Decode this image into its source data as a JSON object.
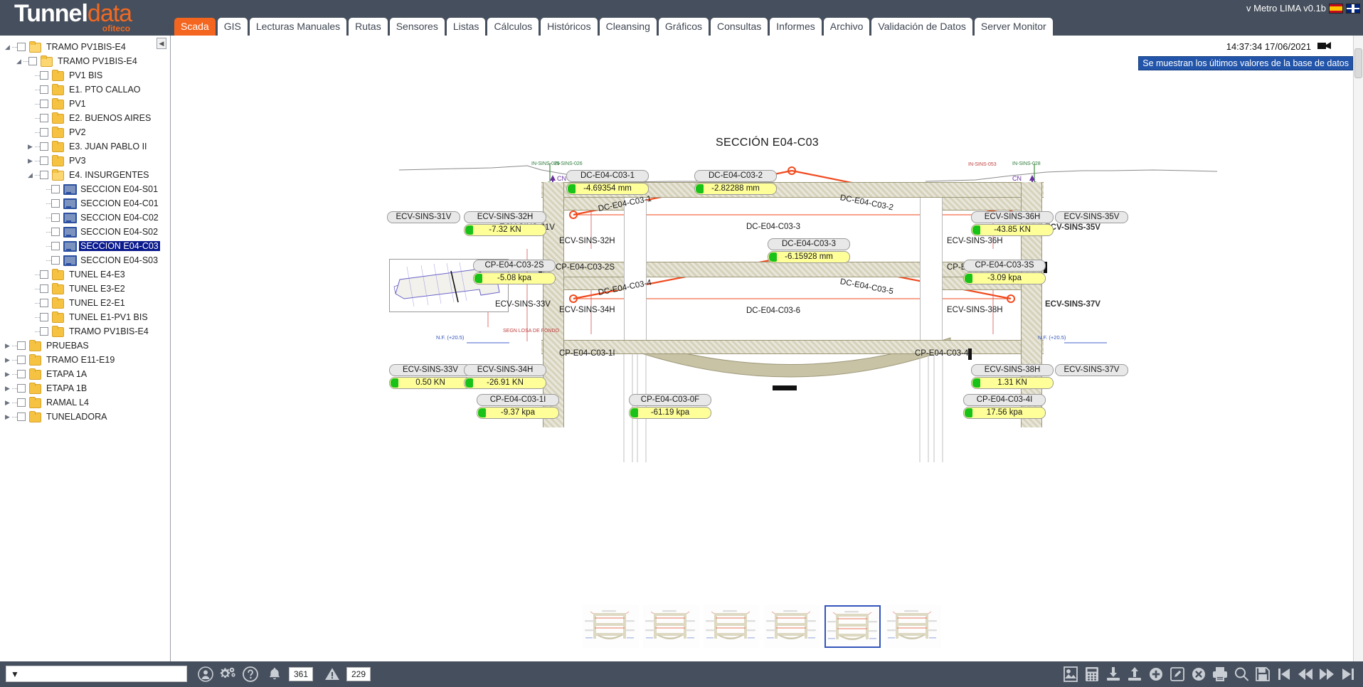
{
  "app": {
    "logo_main": "Tunnel",
    "logo_accent": "data",
    "logo_sub": "ofiteco",
    "version": "v Metro LIMA v0.1b",
    "flag_es": "spain-flag",
    "flag_en": "uk-flag"
  },
  "tabs": [
    {
      "label": "Scada",
      "active": true
    },
    {
      "label": "GIS",
      "active": false
    },
    {
      "label": "Lecturas Manuales",
      "active": false
    },
    {
      "label": "Rutas",
      "active": false
    },
    {
      "label": "Sensores",
      "active": false
    },
    {
      "label": "Listas",
      "active": false
    },
    {
      "label": "Cálculos",
      "active": false
    },
    {
      "label": "Históricos",
      "active": false
    },
    {
      "label": "Cleansing",
      "active": false
    },
    {
      "label": "Gráficos",
      "active": false
    },
    {
      "label": "Consultas",
      "active": false
    },
    {
      "label": "Informes",
      "active": false
    },
    {
      "label": "Archivo",
      "active": false
    },
    {
      "label": "Validación de Datos",
      "active": false
    },
    {
      "label": "Server Monitor",
      "active": false
    }
  ],
  "sidebar": {
    "collapse_label": "◀",
    "nodes": [
      {
        "label": "TRAMO PV1BIS-E4",
        "depth": 0,
        "icon": "folder-open",
        "twisty": "expanded",
        "selected": false
      },
      {
        "label": "TRAMO PV1BIS-E4",
        "depth": 1,
        "icon": "folder-open",
        "twisty": "expanded",
        "selected": false
      },
      {
        "label": "PV1 BIS",
        "depth": 2,
        "icon": "folder",
        "twisty": "none",
        "selected": false
      },
      {
        "label": "E1. PTO CALLAO",
        "depth": 2,
        "icon": "folder",
        "twisty": "none",
        "selected": false
      },
      {
        "label": "PV1",
        "depth": 2,
        "icon": "folder",
        "twisty": "none",
        "selected": false
      },
      {
        "label": "E2. BUENOS AIRES",
        "depth": 2,
        "icon": "folder",
        "twisty": "none",
        "selected": false
      },
      {
        "label": "PV2",
        "depth": 2,
        "icon": "folder",
        "twisty": "none",
        "selected": false
      },
      {
        "label": "E3. JUAN PABLO II",
        "depth": 2,
        "icon": "folder",
        "twisty": "collapsed",
        "selected": false
      },
      {
        "label": "PV3",
        "depth": 2,
        "icon": "folder",
        "twisty": "collapsed",
        "selected": false
      },
      {
        "label": "E4. INSURGENTES",
        "depth": 2,
        "icon": "folder-open",
        "twisty": "expanded",
        "selected": false
      },
      {
        "label": "SECCION E04-S01",
        "depth": 3,
        "icon": "monitor",
        "twisty": "none",
        "selected": false
      },
      {
        "label": "SECCION E04-C01",
        "depth": 3,
        "icon": "monitor",
        "twisty": "none",
        "selected": false
      },
      {
        "label": "SECCION E04-C02",
        "depth": 3,
        "icon": "monitor",
        "twisty": "none",
        "selected": false
      },
      {
        "label": "SECCION E04-S02",
        "depth": 3,
        "icon": "monitor",
        "twisty": "none",
        "selected": false
      },
      {
        "label": "SECCION E04-C03",
        "depth": 3,
        "icon": "monitor",
        "twisty": "none",
        "selected": true
      },
      {
        "label": "SECCION E04-S03",
        "depth": 3,
        "icon": "monitor",
        "twisty": "none",
        "selected": false
      },
      {
        "label": "TUNEL E4-E3",
        "depth": 2,
        "icon": "folder",
        "twisty": "none",
        "selected": false
      },
      {
        "label": "TUNEL E3-E2",
        "depth": 2,
        "icon": "folder",
        "twisty": "none",
        "selected": false
      },
      {
        "label": "TUNEL E2-E1",
        "depth": 2,
        "icon": "folder",
        "twisty": "none",
        "selected": false
      },
      {
        "label": "TUNEL E1-PV1 BIS",
        "depth": 2,
        "icon": "folder",
        "twisty": "none",
        "selected": false
      },
      {
        "label": "TRAMO PV1BIS-E4",
        "depth": 2,
        "icon": "folder",
        "twisty": "none",
        "selected": false
      },
      {
        "label": "PRUEBAS",
        "depth": 0,
        "icon": "folder",
        "twisty": "collapsed",
        "selected": false
      },
      {
        "label": "TRAMO E11-E19",
        "depth": 0,
        "icon": "folder",
        "twisty": "collapsed",
        "selected": false
      },
      {
        "label": "ETAPA 1A",
        "depth": 0,
        "icon": "folder",
        "twisty": "collapsed",
        "selected": false
      },
      {
        "label": "ETAPA 1B",
        "depth": 0,
        "icon": "folder",
        "twisty": "collapsed",
        "selected": false
      },
      {
        "label": "RAMAL L4",
        "depth": 0,
        "icon": "folder",
        "twisty": "collapsed",
        "selected": false
      },
      {
        "label": "TUNELADORA",
        "depth": 0,
        "icon": "folder",
        "twisty": "collapsed",
        "selected": false
      }
    ]
  },
  "main": {
    "timestamp": "14:37:34 17/06/2021",
    "banner": "Se muestran los últimos valores de la base de datos",
    "diagram_title": "SECCIÓN E04-C03"
  },
  "sensors": [
    {
      "name": "DC-E04-C03-1",
      "value": "-4.69354 mm",
      "status": "ok"
    },
    {
      "name": "DC-E04-C03-2",
      "value": "-2.82288 mm",
      "status": "ok"
    },
    {
      "name": "ECV-SINS-32H",
      "value": "-7.32 KN",
      "status": "ok"
    },
    {
      "name": "ECV-SINS-36H",
      "value": "-43.85 KN",
      "status": "ok"
    },
    {
      "name": "DC-E04-C03-3",
      "value": "-6.15928 mm",
      "status": "ok"
    },
    {
      "name": "CP-E04-C03-2S",
      "value": "-5.08 kpa",
      "status": "ok"
    },
    {
      "name": "CP-E04-C03-3S",
      "value": "-3.09 kpa",
      "status": "ok"
    },
    {
      "name": "ECV-SINS-33V",
      "value": "0.50 KN",
      "status": "ok"
    },
    {
      "name": "ECV-SINS-34H",
      "value": "-26.91 KN",
      "status": "ok"
    },
    {
      "name": "ECV-SINS-38H",
      "value": "1.31 KN",
      "status": "ok"
    },
    {
      "name": "CP-E04-C03-1I",
      "value": "-9.37 kpa",
      "status": "ok"
    },
    {
      "name": "CP-E04-C03-0F",
      "value": "-61.19 kpa",
      "status": "ok"
    },
    {
      "name": "CP-E04-C03-4I",
      "value": "17.56 kpa",
      "status": "ok"
    }
  ],
  "pills": [
    {
      "label": "ECV-SINS-31V"
    },
    {
      "label": "ECV-SINS-35V"
    },
    {
      "label": "ECV-SINS-37V"
    }
  ],
  "diagram_labels": [
    {
      "label": "ECV-SINS-31V"
    },
    {
      "label": "ECV-SINS-32H"
    },
    {
      "label": "ECV-SINS-33V"
    },
    {
      "label": "ECV-SINS-34H"
    },
    {
      "label": "ECV-SINS-35V"
    },
    {
      "label": "ECV-SINS-36H"
    },
    {
      "label": "ECV-SINS-37V"
    },
    {
      "label": "ECV-SINS-38H"
    },
    {
      "label": "DC-E04-C03-1"
    },
    {
      "label": "DC-E04-C03-2"
    },
    {
      "label": "DC-E04-C03-3"
    },
    {
      "label": "DC-E04-C03-4"
    },
    {
      "label": "DC-E04-C03-5"
    },
    {
      "label": "DC-E04-C03-6"
    },
    {
      "label": "CP-E04-C03-2S"
    },
    {
      "label": "CP-E04-C03-3S"
    },
    {
      "label": "CP-E04-C03-1I"
    },
    {
      "label": "CP-E04-C03-4I"
    },
    {
      "label": "CN"
    },
    {
      "label": "IN-SINS-025"
    },
    {
      "label": "IN-SINS-026"
    },
    {
      "label": "IN-SINS-028"
    },
    {
      "label": "IN-SINS-053"
    },
    {
      "label": "N.F. (+20.5)"
    },
    {
      "label": "SEGN LOSA DE FONDO"
    }
  ],
  "thumbnails": [
    {
      "index": 1,
      "selected": false
    },
    {
      "index": 2,
      "selected": false
    },
    {
      "index": 3,
      "selected": false
    },
    {
      "index": 4,
      "selected": false
    },
    {
      "index": 5,
      "selected": true
    },
    {
      "index": 6,
      "selected": false
    }
  ],
  "statusbar": {
    "filter_value": "",
    "filter_placeholder": "",
    "alarm_count": "361",
    "warning_count": "229",
    "icons": [
      "filter-icon",
      "user-icon",
      "gears-icon",
      "help-icon",
      "bell-icon",
      "warning-icon"
    ],
    "right_icons": [
      "image-export-icon",
      "calculator-icon",
      "download-icon",
      "upload-icon",
      "add-icon",
      "edit-icon",
      "delete-icon",
      "print-icon",
      "search-icon",
      "save-icon",
      "first-icon",
      "prev-icon",
      "next-icon",
      "last-icon"
    ]
  }
}
